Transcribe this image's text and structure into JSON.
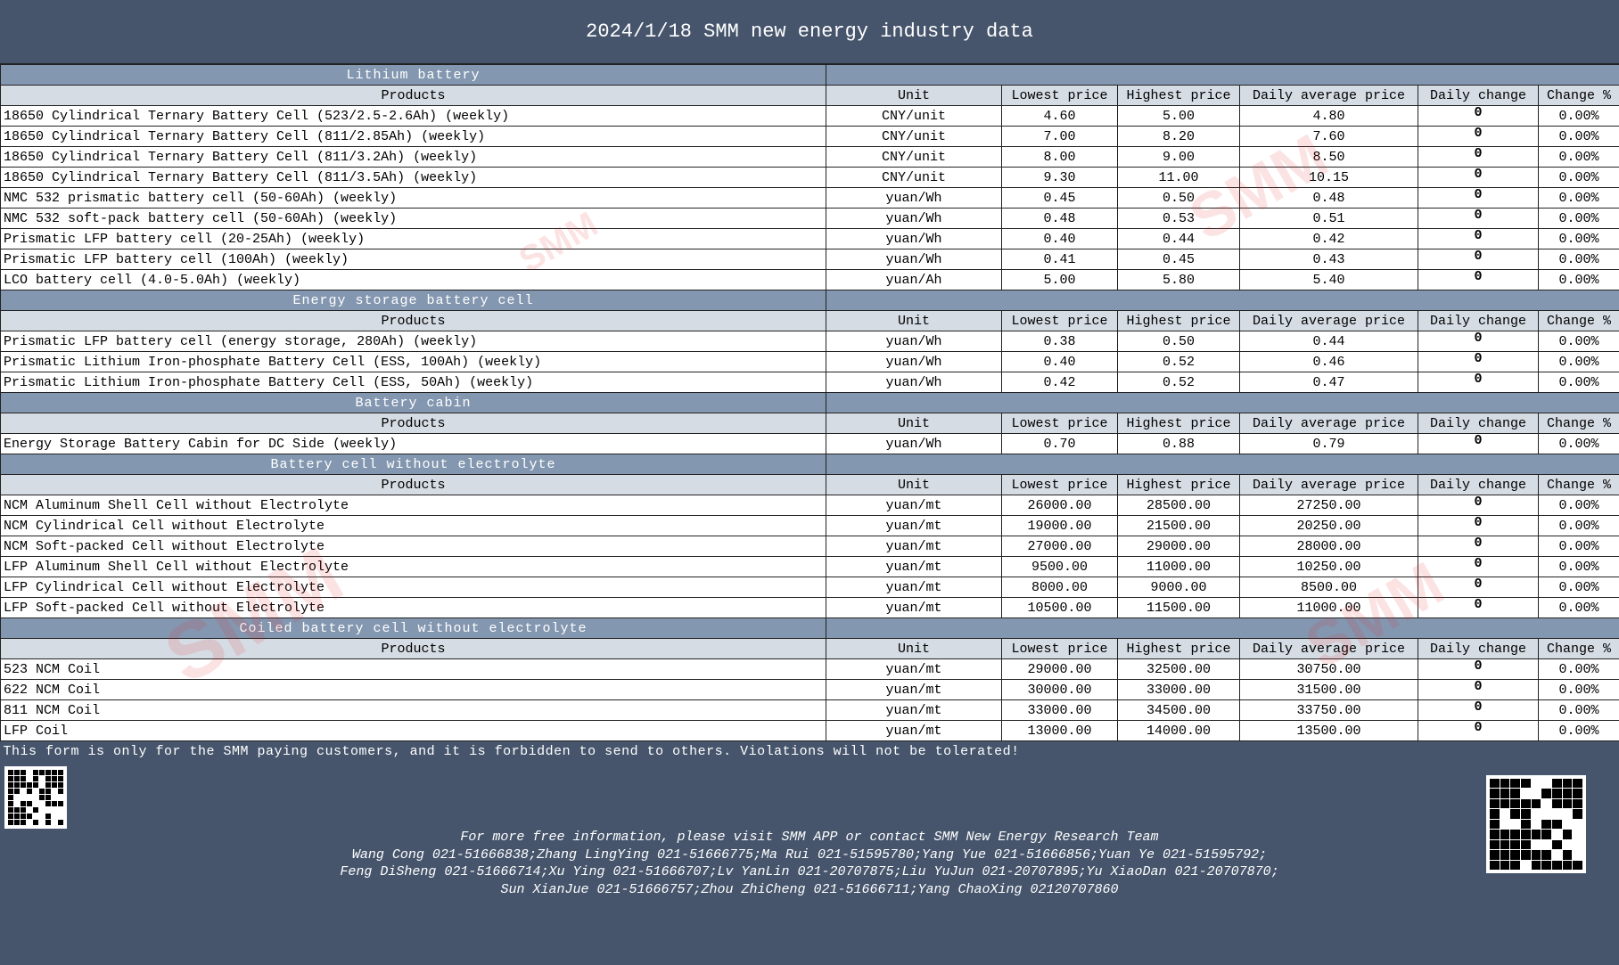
{
  "title": "2024/1/18 SMM new energy industry data",
  "headers": [
    "Products",
    "Unit",
    "Lowest price",
    "Highest price",
    "Daily average price",
    "Daily change",
    "Change %"
  ],
  "sections": [
    {
      "name": "Lithium battery",
      "rows": [
        [
          "18650 Cylindrical Ternary Battery Cell (523/2.5-2.6Ah) (weekly)",
          "CNY/unit",
          "4.60",
          "5.00",
          "4.80",
          "0",
          "0.00%"
        ],
        [
          "18650 Cylindrical Ternary Battery Cell (811/2.85Ah) (weekly)",
          "CNY/unit",
          "7.00",
          "8.20",
          "7.60",
          "0",
          "0.00%"
        ],
        [
          "18650 Cylindrical Ternary Battery Cell (811/3.2Ah) (weekly)",
          "CNY/unit",
          "8.00",
          "9.00",
          "8.50",
          "0",
          "0.00%"
        ],
        [
          "18650 Cylindrical Ternary Battery Cell (811/3.5Ah) (weekly)",
          "CNY/unit",
          "9.30",
          "11.00",
          "10.15",
          "0",
          "0.00%"
        ],
        [
          "NMC 532 prismatic battery cell (50-60Ah) (weekly)",
          "yuan/Wh",
          "0.45",
          "0.50",
          "0.48",
          "0",
          "0.00%"
        ],
        [
          "NMC 532 soft-pack battery cell (50-60Ah) (weekly)",
          "yuan/Wh",
          "0.48",
          "0.53",
          "0.51",
          "0",
          "0.00%"
        ],
        [
          "Prismatic LFP battery cell (20-25Ah) (weekly)",
          "yuan/Wh",
          "0.40",
          "0.44",
          "0.42",
          "0",
          "0.00%"
        ],
        [
          "Prismatic LFP battery cell (100Ah) (weekly)",
          "yuan/Wh",
          "0.41",
          "0.45",
          "0.43",
          "0",
          "0.00%"
        ],
        [
          "LCO battery cell (4.0-5.0Ah) (weekly)",
          "yuan/Ah",
          "5.00",
          "5.80",
          "5.40",
          "0",
          "0.00%"
        ]
      ]
    },
    {
      "name": "Energy storage battery cell",
      "rows": [
        [
          "Prismatic LFP battery cell (energy storage, 280Ah) (weekly)",
          "yuan/Wh",
          "0.38",
          "0.50",
          "0.44",
          "0",
          "0.00%"
        ],
        [
          "Prismatic Lithium Iron-phosphate Battery Cell (ESS, 100Ah) (weekly)",
          "yuan/Wh",
          "0.40",
          "0.52",
          "0.46",
          "0",
          "0.00%"
        ],
        [
          "Prismatic Lithium Iron-phosphate Battery Cell (ESS, 50Ah) (weekly)",
          "yuan/Wh",
          "0.42",
          "0.52",
          "0.47",
          "0",
          "0.00%"
        ]
      ]
    },
    {
      "name": "Battery cabin",
      "rows": [
        [
          "Energy Storage Battery Cabin for DC Side  (weekly)",
          "yuan/Wh",
          "0.70",
          "0.88",
          "0.79",
          "0",
          "0.00%"
        ]
      ]
    },
    {
      "name": "Battery cell without electrolyte",
      "rows": [
        [
          "NCM Aluminum Shell Cell without Electrolyte",
          "yuan/mt",
          "26000.00",
          "28500.00",
          "27250.00",
          "0",
          "0.00%"
        ],
        [
          "NCM Cylindrical  Cell without Electrolyte",
          "yuan/mt",
          "19000.00",
          "21500.00",
          "20250.00",
          "0",
          "0.00%"
        ],
        [
          "NCM Soft-packed  Cell without Electrolyte",
          "yuan/mt",
          "27000.00",
          "29000.00",
          "28000.00",
          "0",
          "0.00%"
        ],
        [
          "LFP Aluminum Shell Cell without Electrolyte",
          "yuan/mt",
          "9500.00",
          "11000.00",
          "10250.00",
          "0",
          "0.00%"
        ],
        [
          "LFP Cylindrical  Cell without Electrolyte",
          "yuan/mt",
          "8000.00",
          "9000.00",
          "8500.00",
          "0",
          "0.00%"
        ],
        [
          "LFP Soft-packed  Cell without Electrolyte",
          "yuan/mt",
          "10500.00",
          "11500.00",
          "11000.00",
          "0",
          "0.00%"
        ]
      ]
    },
    {
      "name": "Coiled battery cell without electrolyte",
      "rows": [
        [
          "523 NCM Coil",
          "yuan/mt",
          "29000.00",
          "32500.00",
          "30750.00",
          "0",
          "0.00%"
        ],
        [
          "622 NCM Coil",
          "yuan/mt",
          "30000.00",
          "33000.00",
          "31500.00",
          "0",
          "0.00%"
        ],
        [
          "811 NCM Coil",
          "yuan/mt",
          "33000.00",
          "34500.00",
          "33750.00",
          "0",
          "0.00%"
        ],
        [
          "LFP Coil",
          "yuan/mt",
          "13000.00",
          "14000.00",
          "13500.00",
          "0",
          "0.00%"
        ]
      ]
    }
  ],
  "notice": "This form is only for the SMM paying customers, and it is forbidden to send to others. Violations will not be tolerated!",
  "footer": [
    "For more free information, please visit SMM APP or contact SMM New Energy Research Team",
    "Wang Cong 021-51666838;Zhang LingYing 021-51666775;Ma Rui 021-51595780;Yang Yue 021-51666856;Yuan Ye 021-51595792;",
    "Feng DiSheng 021-51666714;Xu Ying 021-51666707;Lv YanLin 021-20707875;Liu YuJun 021-20707895;Yu XiaoDan 021-20707870;",
    "Sun XianJue 021-51666757;Zhou ZhiCheng     021-51666711;Yang ChaoXing 02120707860"
  ],
  "watermark": "SMM 上海有色网"
}
